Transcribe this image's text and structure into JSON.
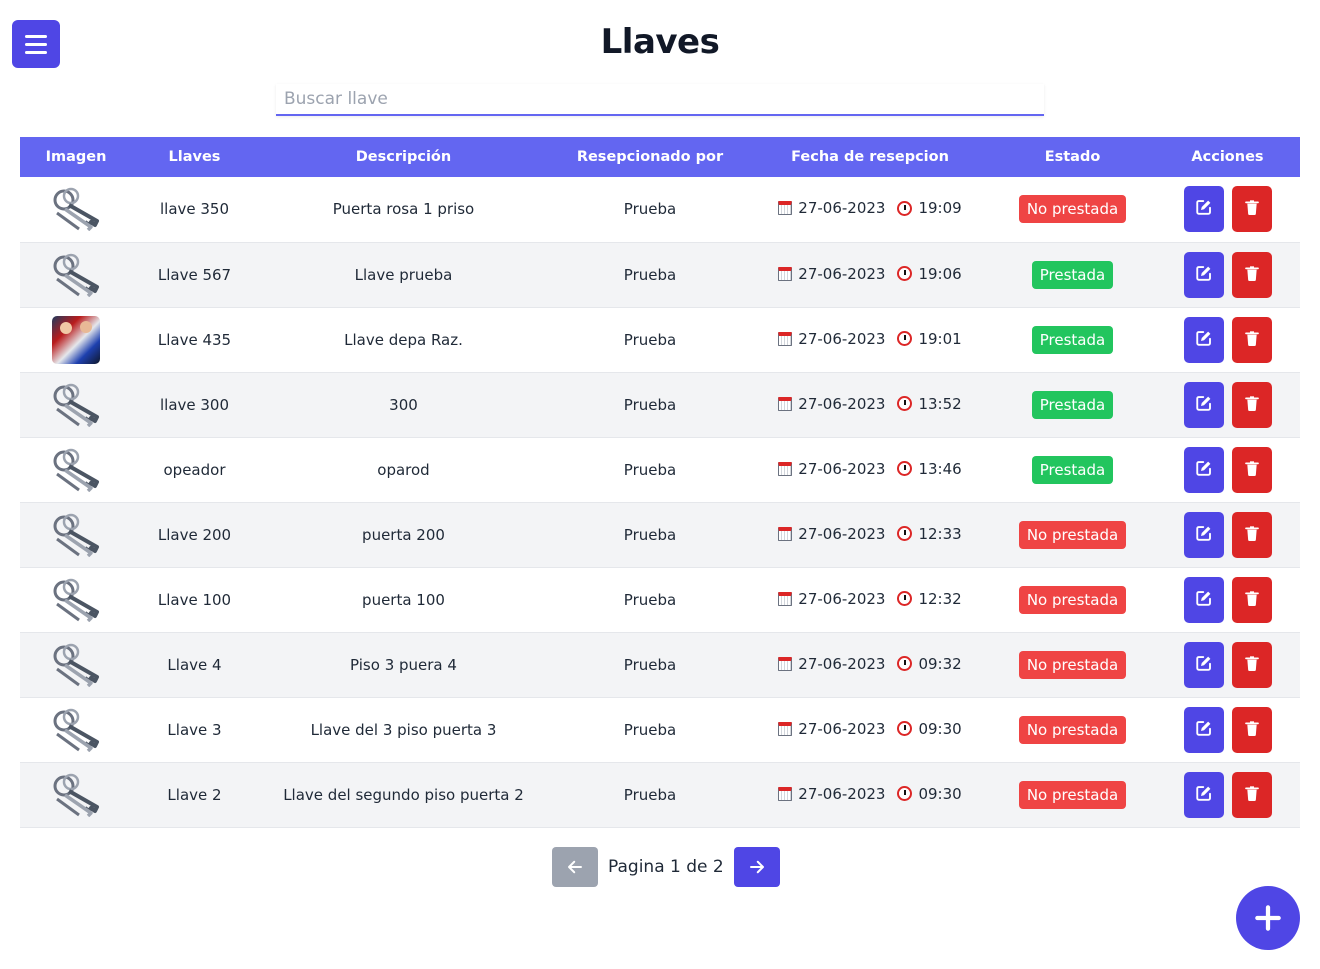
{
  "page": {
    "title": "Llaves"
  },
  "search": {
    "placeholder": "Buscar llave"
  },
  "table": {
    "headers": [
      "Imagen",
      "Llaves",
      "Descripción",
      "Resepcionado por",
      "Fecha de resepcion",
      "Estado",
      "Acciones"
    ],
    "rows": [
      {
        "image": "keys-icon",
        "name": "llave 350",
        "description": "Puerta rosa 1 priso",
        "received_by": "Prueba",
        "date": "27-06-2023",
        "time": "19:09",
        "status": "No prestada"
      },
      {
        "image": "keys-icon",
        "name": "Llave 567",
        "description": "Llave prueba",
        "received_by": "Prueba",
        "date": "27-06-2023",
        "time": "19:06",
        "status": "Prestada"
      },
      {
        "image": "photo",
        "name": "Llave 435",
        "description": "Llave depa Raz.",
        "received_by": "Prueba",
        "date": "27-06-2023",
        "time": "19:01",
        "status": "Prestada"
      },
      {
        "image": "keys-icon",
        "name": "llave 300",
        "description": "300",
        "received_by": "Prueba",
        "date": "27-06-2023",
        "time": "13:52",
        "status": "Prestada"
      },
      {
        "image": "keys-icon",
        "name": "opeador",
        "description": "oparod",
        "received_by": "Prueba",
        "date": "27-06-2023",
        "time": "13:46",
        "status": "Prestada"
      },
      {
        "image": "keys-icon",
        "name": "Llave 200",
        "description": "puerta 200",
        "received_by": "Prueba",
        "date": "27-06-2023",
        "time": "12:33",
        "status": "No prestada"
      },
      {
        "image": "keys-icon",
        "name": "Llave 100",
        "description": "puerta 100",
        "received_by": "Prueba",
        "date": "27-06-2023",
        "time": "12:32",
        "status": "No prestada"
      },
      {
        "image": "keys-icon",
        "name": "Llave 4",
        "description": "Piso 3 puera 4",
        "received_by": "Prueba",
        "date": "27-06-2023",
        "time": "09:32",
        "status": "No prestada"
      },
      {
        "image": "keys-icon",
        "name": "Llave 3",
        "description": "Llave del 3 piso puerta 3",
        "received_by": "Prueba",
        "date": "27-06-2023",
        "time": "09:30",
        "status": "No prestada"
      },
      {
        "image": "keys-icon",
        "name": "Llave 2",
        "description": "Llave del segundo piso puerta 2",
        "received_by": "Prueba",
        "date": "27-06-2023",
        "time": "09:30",
        "status": "No prestada"
      }
    ]
  },
  "pagination": {
    "text": "Pagina 1 de 2"
  },
  "colors": {
    "accent": "#4f46e5",
    "header": "#6366f1",
    "danger": "#dc2626",
    "badge_no": "#ef4444",
    "badge_yes": "#22c55e"
  }
}
